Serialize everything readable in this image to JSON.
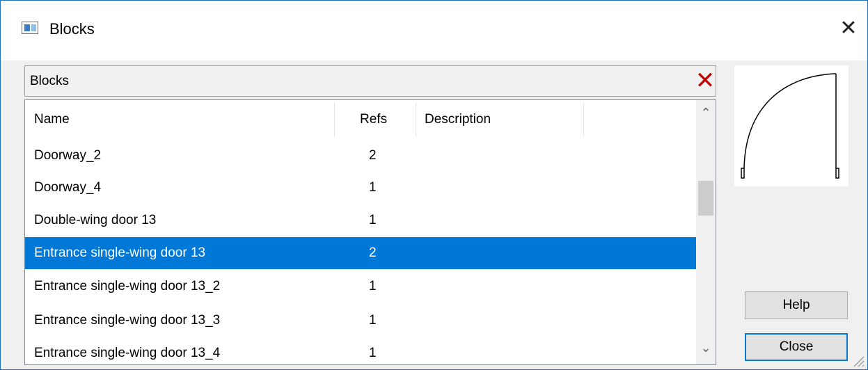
{
  "window": {
    "title": "Blocks"
  },
  "panel": {
    "title": "Blocks",
    "delete_icon": "delete-x-icon",
    "accent_delete": "#c00000"
  },
  "table": {
    "columns": [
      "Name",
      "Refs",
      "Description"
    ],
    "rows": [
      {
        "name": "Doorway_2",
        "refs": "2",
        "description": ""
      },
      {
        "name": "Doorway_4",
        "refs": "1",
        "description": ""
      },
      {
        "name": "Double-wing door 13",
        "refs": "1",
        "description": ""
      },
      {
        "name": "Entrance single-wing door 13",
        "refs": "2",
        "description": "",
        "selected": true
      },
      {
        "name": "Entrance single-wing door 13_2",
        "refs": "1",
        "description": ""
      },
      {
        "name": "Entrance single-wing door 13_3",
        "refs": "1",
        "description": ""
      },
      {
        "name": "Entrance single-wing door 13_4",
        "refs": "1",
        "description": ""
      }
    ],
    "selection_color": "#0078d7"
  },
  "buttons": {
    "help": "Help",
    "close": "Close"
  }
}
